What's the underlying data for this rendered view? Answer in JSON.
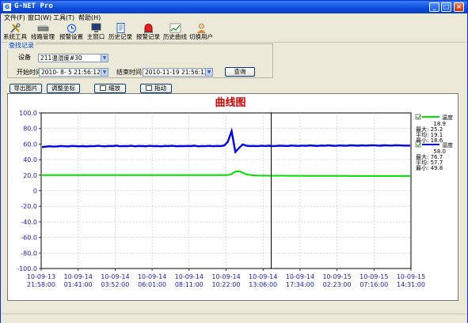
{
  "window": {
    "title": "G-NET Pro",
    "icon_label": "G",
    "minimize": "_",
    "maximize": "□",
    "close": "×"
  },
  "menu": [
    {
      "label": "文件(F)"
    },
    {
      "label": "窗口(W)"
    },
    {
      "label": "工具(T)"
    },
    {
      "label": "帮助(H)"
    }
  ],
  "toolbar": [
    {
      "label": "系统工具",
      "icon": "tools-icon"
    },
    {
      "label": "线路管理",
      "icon": "line-manage-icon"
    },
    {
      "label": "报警设置",
      "icon": "alarm-clock-icon"
    },
    {
      "label": "主窗口",
      "icon": "monitor-icon"
    },
    {
      "label": "历史记录",
      "icon": "document-icon"
    },
    {
      "label": "报警记录",
      "icon": "siren-icon"
    },
    {
      "label": "历史曲线",
      "icon": "curve-icon"
    },
    {
      "label": "切换用户",
      "icon": "user-icon"
    }
  ],
  "query": {
    "group_title": "查找记录",
    "device_label": "设备",
    "device_value": "211温湿度#30",
    "start_label": "开始时间",
    "start_value": "2010- 8- 5 21:56:12",
    "end_label": "结束时间",
    "end_value": "2010-11-19 21:56:12",
    "query_button": "查询"
  },
  "actions": {
    "export_image": "导出图片",
    "adjust_axis": "调整坐标",
    "zoom": "缩放",
    "pan": "拖动"
  },
  "chart_data": {
    "type": "line",
    "title": "曲线图",
    "xlabel": "",
    "ylabel": "",
    "ylim": [
      -100,
      100
    ],
    "y_ticks": [
      "100.0",
      "80.0",
      "60.0",
      "40.0",
      "20.0",
      "0",
      "-20.0",
      "-40.0",
      "-60.0",
      "-80.0",
      "-100.0"
    ],
    "x_ticks": [
      [
        "10-09-13",
        "21:58:00"
      ],
      [
        "10-09-14",
        "01:41:00"
      ],
      [
        "10-09-14",
        "03:52:00"
      ],
      [
        "10-09-14",
        "06:01:00"
      ],
      [
        "10-09-14",
        "08:11:00"
      ],
      [
        "10-09-14",
        "10:22:00"
      ],
      [
        "10-09-14",
        "13:06:00"
      ],
      [
        "10-09-14",
        "17:34:00"
      ],
      [
        "10-09-15",
        "02:23:00"
      ],
      [
        "10-09-15",
        "07:16:00"
      ],
      [
        "10-09-15",
        "14:31:00"
      ]
    ],
    "grid": true,
    "cursor_x_fraction": 0.622,
    "series": [
      {
        "name": "温度",
        "color": "#00e000",
        "values": [
          20.0,
          20.0,
          20.0,
          20.0,
          20.0,
          20.1,
          20.0,
          20.0,
          20.0,
          20.0,
          20.0,
          20.0,
          20.1,
          20.0,
          20.0,
          20.0,
          20.0,
          20.0,
          20.0,
          20.0,
          20.0,
          20.0,
          20.0,
          20.0,
          20.1,
          20.0,
          20.0,
          20.0,
          20.0,
          20.0,
          20.0,
          20.0,
          20.0,
          20.0,
          20.0,
          20.0,
          20.0,
          20.0,
          20.0,
          20.0,
          20.0,
          20.0,
          20.0,
          20.0,
          20.0,
          20.0,
          20.0,
          20.0,
          20.0,
          20.0,
          20.2,
          21.5,
          24.5,
          25.2,
          23.0,
          21.0,
          20.2,
          19.8,
          19.5,
          19.4,
          19.4,
          19.3,
          19.3,
          19.3,
          19.3,
          19.3,
          19.2,
          19.2,
          19.2,
          19.2,
          19.2,
          19.1,
          19.1,
          19.1,
          19.1,
          19.1,
          19.1,
          19.0,
          19.0,
          19.0,
          19.0,
          19.0,
          19.0,
          18.9,
          18.9,
          18.9,
          18.9,
          18.9,
          18.9,
          18.9,
          18.9,
          18.9,
          18.9,
          18.9,
          18.9,
          18.9,
          18.9,
          18.9,
          18.9,
          18.9
        ],
        "current": "18.9",
        "max": "25.2",
        "avg": "19.1",
        "min": "18.6"
      },
      {
        "name": "湿度",
        "color": "#0000e0",
        "values": [
          56.0,
          56.6,
          57.2,
          56.8,
          57.0,
          57.5,
          57.2,
          57.0,
          57.6,
          57.3,
          57.1,
          57.4,
          57.0,
          57.5,
          57.2,
          57.8,
          57.3,
          57.1,
          57.6,
          57.4,
          57.9,
          57.2,
          57.5,
          57.3,
          57.8,
          57.1,
          57.6,
          57.4,
          57.2,
          57.7,
          57.3,
          57.5,
          57.1,
          57.6,
          57.4,
          57.8,
          57.2,
          57.5,
          57.3,
          57.6,
          57.4,
          57.9,
          57.1,
          57.5,
          57.3,
          57.7,
          57.2,
          57.6,
          57.4,
          58.2,
          63.0,
          76.7,
          49.8,
          55.0,
          59.5,
          57.8,
          57.4,
          57.6,
          57.3,
          57.8,
          57.5,
          57.9,
          57.4,
          57.6,
          58.0,
          57.7,
          57.5,
          58.1,
          57.8,
          57.6,
          58.0,
          57.7,
          58.2,
          57.9,
          57.6,
          58.1,
          57.8,
          58.3,
          57.9,
          57.7,
          58.2,
          58.0,
          57.8,
          58.4,
          58.1,
          57.9,
          58.3,
          58.0,
          58.2,
          58.5,
          58.1,
          57.9,
          58.4,
          58.2,
          58.0,
          58.5,
          58.3,
          58.1,
          58.0,
          58.0
        ],
        "current": "58.0",
        "max": "76.7",
        "avg": "57.7",
        "min": "49.8"
      }
    ]
  },
  "legend": {
    "max_label": "最大:",
    "avg_label": "平均:",
    "min_label": "最小:"
  }
}
